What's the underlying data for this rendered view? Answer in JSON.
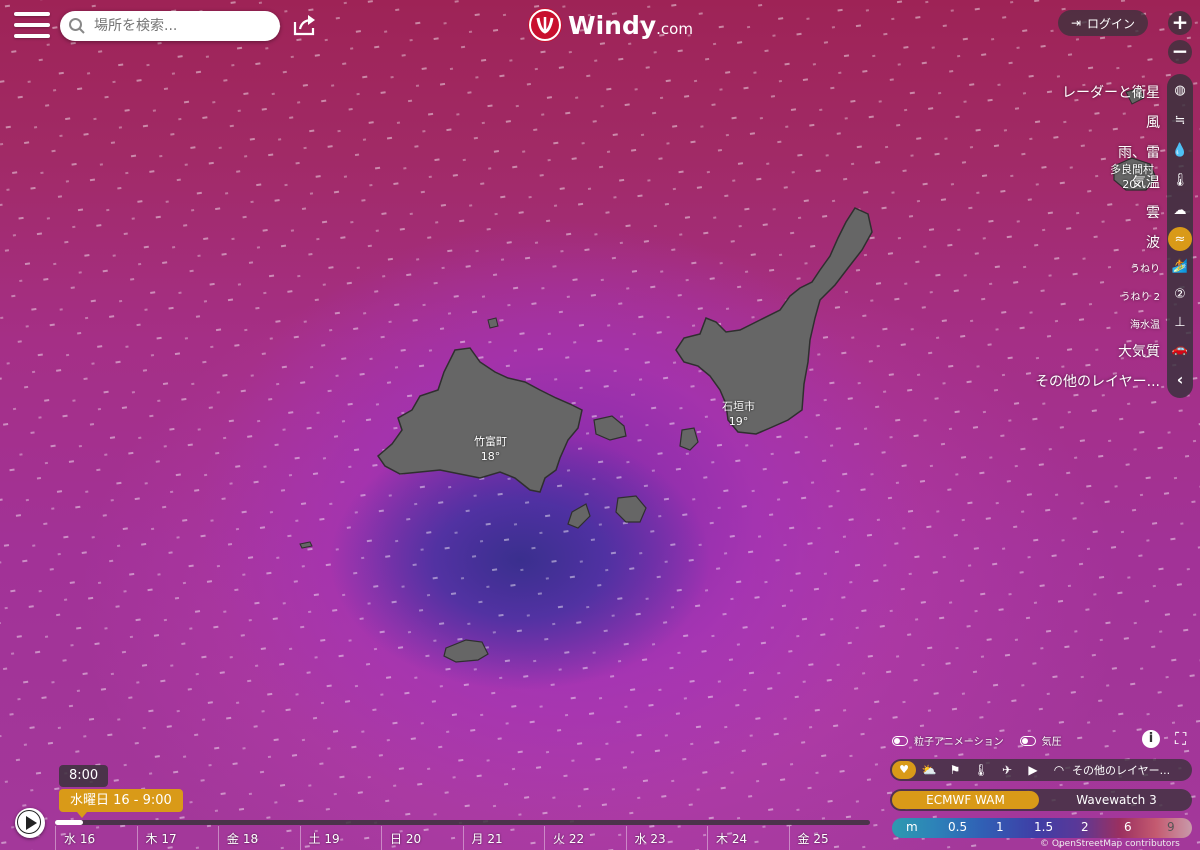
{
  "header": {
    "search_placeholder": "場所を検索...",
    "logo_text": "Windy",
    "logo_tld": ".com",
    "login_label": "ログイン"
  },
  "zoom": {
    "plus": "+",
    "minus": "−"
  },
  "layers": {
    "items": [
      {
        "label": "レーダーと衛星",
        "icon": "globe-icon"
      },
      {
        "label": "風",
        "icon": "wind-icon"
      },
      {
        "label": "雨、雷",
        "icon": "raindrop-icon"
      },
      {
        "label": "気温",
        "icon": "thermometer-icon"
      },
      {
        "label": "雲",
        "icon": "cloud-icon"
      },
      {
        "label": "波",
        "icon": "waves-icon",
        "active": true
      },
      {
        "label": "うねり",
        "icon": "swell-icon"
      },
      {
        "label": "うねり 2",
        "icon": "swell-2-icon"
      },
      {
        "label": "海水温",
        "icon": "sea-temperature-icon"
      },
      {
        "label": "大気質",
        "icon": "car-icon"
      },
      {
        "label": "その他のレイヤー...",
        "icon": "chevron-left-icon"
      }
    ]
  },
  "map_labels": {
    "taketomi_name": "竹富町",
    "taketomi_temp": "18°",
    "ishigaki_name": "石垣市",
    "ishigaki_temp": "19°",
    "tarama_name": "多良間村",
    "tarama_temp": "20°"
  },
  "overlay_controls": {
    "particles_label": "粒子アニメーション",
    "pressure_label": "気圧",
    "info": "i",
    "more_layers": "その他のレイヤー..."
  },
  "models": {
    "items": [
      {
        "label": "ECMWF WAM",
        "active": true
      },
      {
        "label": "Wavewatch 3",
        "active": false
      }
    ]
  },
  "legend": {
    "unit": "m",
    "values": [
      "0.5",
      "1",
      "1.5",
      "2",
      "6",
      "9"
    ]
  },
  "copyright": "© OpenStreetMap contributors",
  "timeline": {
    "hover_time": "8:00",
    "current": "水曜日 16 - 9:00",
    "progress": 0.034,
    "days": [
      "水 16",
      "木 17",
      "金 18",
      "土 19",
      "日 20",
      "月 21",
      "火 22",
      "水 23",
      "木 24",
      "金 25"
    ]
  },
  "colors": {
    "accent": "#d99a18",
    "brand_red": "#c8102e",
    "panel": "#3c323c"
  }
}
